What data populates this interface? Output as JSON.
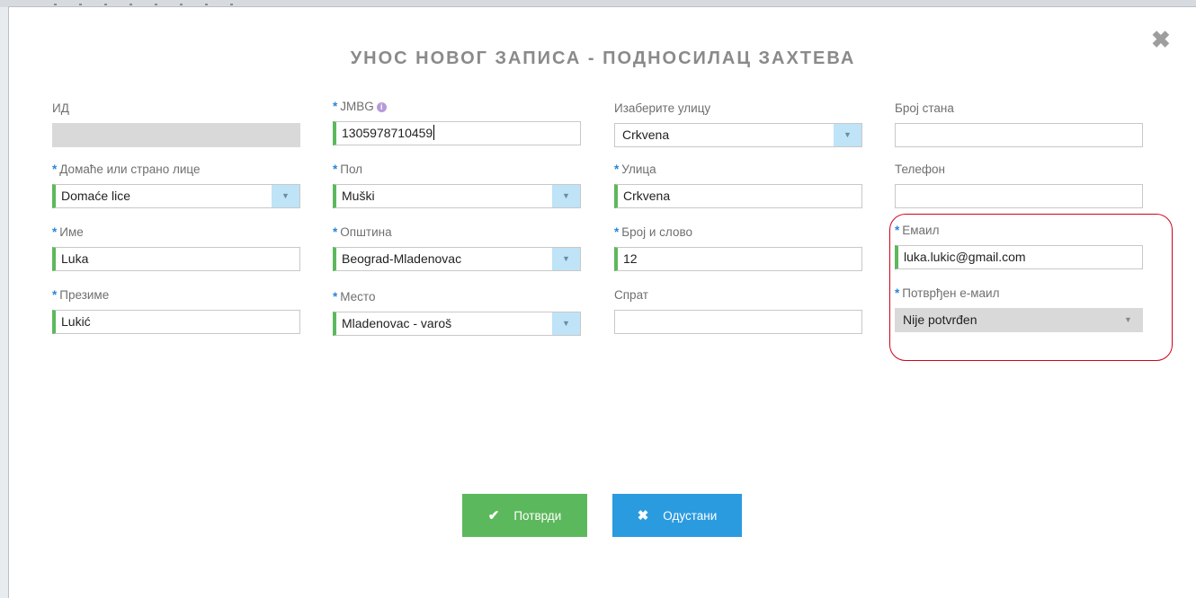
{
  "modal": {
    "title": "УНОС НОВОГ ЗАПИСА - ПОДНОСИЛАЦ ЗАХТЕВА",
    "close_icon": "close-icon"
  },
  "fields": {
    "id": {
      "label": "ИД",
      "value": ""
    },
    "jmbg": {
      "label": "JMBG",
      "value": "1305978710459",
      "info_icon": "info-icon"
    },
    "street_select": {
      "label": "Изаберите улицу",
      "value": "Crkvena"
    },
    "apartment": {
      "label": "Број стана",
      "value": ""
    },
    "person_type": {
      "label": "Домаће или страно лице",
      "value": "Domaće lice"
    },
    "sex": {
      "label": "Пол",
      "value": "Muški"
    },
    "street": {
      "label": "Улица",
      "value": "Crkvena"
    },
    "phone": {
      "label": "Телефон",
      "value": ""
    },
    "first_name": {
      "label": "Име",
      "value": "Luka"
    },
    "municipality": {
      "label": "Општина",
      "value": "Beograd-Mladenovac"
    },
    "house_number": {
      "label": "Број и слово",
      "value": "12"
    },
    "email": {
      "label": "Емаил",
      "value": "luka.lukic@gmail.com"
    },
    "last_name": {
      "label": "Презиме",
      "value": "Lukić"
    },
    "place": {
      "label": "Место",
      "value": "Mladenovac - varoš"
    },
    "floor": {
      "label": "Спрат",
      "value": ""
    },
    "email_confirmed": {
      "label": "Потврђен е-маил",
      "value": "Nije potvrđen"
    }
  },
  "buttons": {
    "confirm": {
      "label": "Потврди",
      "icon": "check-icon"
    },
    "cancel": {
      "label": "Одустани",
      "icon": "x-icon"
    }
  },
  "colors": {
    "required_marker": "#2a86d8",
    "required_border": "#5cb85c",
    "confirm": "#5cb85c",
    "cancel": "#2b9be0",
    "highlight": "#d0021b"
  }
}
